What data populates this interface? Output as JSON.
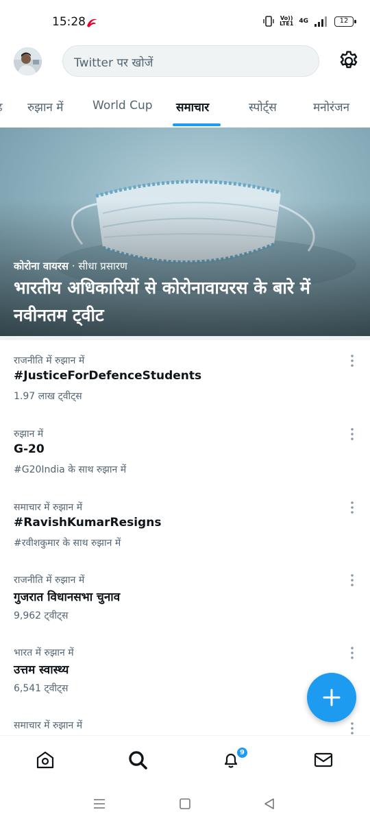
{
  "status_bar": {
    "time": "15:28",
    "volte_line1": "Vo))",
    "volte_line2": "LTE1",
    "network": "4G",
    "battery": "12"
  },
  "header": {
    "search_placeholder": "Twitter पर खोजें"
  },
  "tabs": [
    {
      "label": "रुझान में"
    },
    {
      "label": "World Cup"
    },
    {
      "label": "समाचार",
      "active": true
    },
    {
      "label": "स्पोर्ट्स"
    },
    {
      "label": "मनोरंजन"
    }
  ],
  "hero": {
    "topic": "कोरोना वायरस",
    "separator": " · ",
    "live_label": "सीधा प्रसारण",
    "title": "भारतीय अधिकारियों से कोरोनावायरस के बारे में नवीनतम ट्वीट"
  },
  "trends": [
    {
      "context": "राजनीति में रुझान में",
      "name": "#JusticeForDefenceStudents",
      "meta": "1.97 लाख ट्वीट्स"
    },
    {
      "context": "रुझान में",
      "name": "G-20",
      "meta_highlight": "#G20India",
      "meta": " के साथ रुझान में"
    },
    {
      "context": "समाचार में रुझान में",
      "name": "#RavishKumarResigns",
      "meta_highlight": "#रवीशकुमार",
      "meta": " के साथ रुझान में"
    },
    {
      "context": "राजनीति में रुझान में",
      "name": "गुजरात विधानसभा चुनाव",
      "meta": "9,962 ट्वीट्स"
    },
    {
      "context": "भारत में रुझान में",
      "name": "उत्तम स्वास्थ्य",
      "meta": "6,541 ट्वीट्स"
    },
    {
      "context": "समाचार में रुझान में",
      "name": "",
      "meta": ""
    }
  ],
  "bottom_nav": {
    "notifications_badge": "9",
    "items": [
      "home-icon",
      "search-icon",
      "bell-icon",
      "mail-icon"
    ]
  },
  "colors": {
    "accent": "#1d9bf0",
    "text_primary": "#0f1419",
    "text_secondary": "#536471"
  }
}
